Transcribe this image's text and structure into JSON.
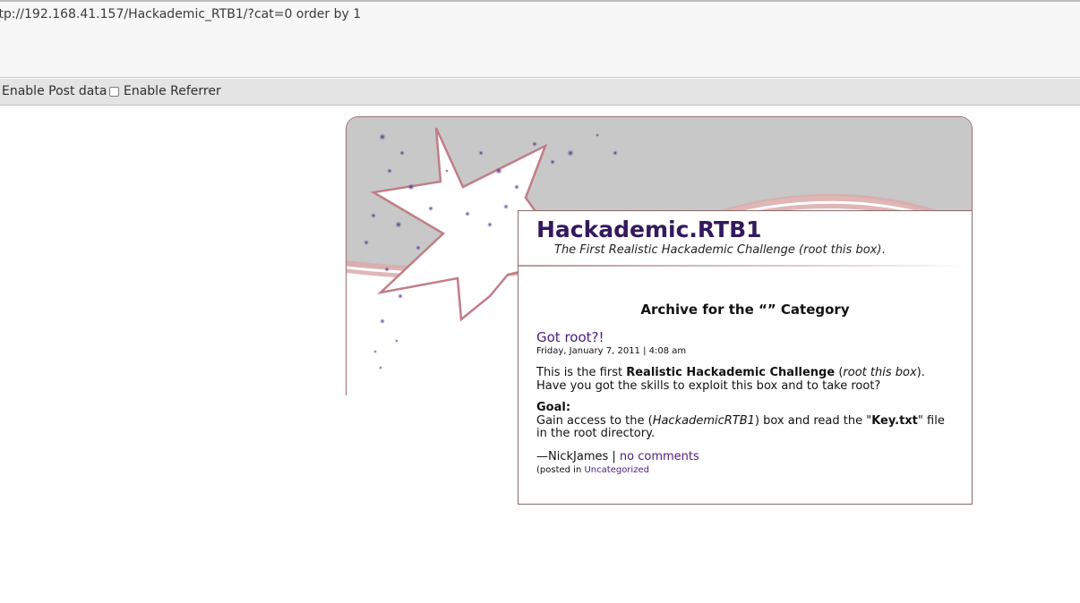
{
  "hackbar": {
    "url": "ttp://192.168.41.157/Hackademic_RTB1/?cat=0 order by 1",
    "enable_post_label": "Enable Post data",
    "enable_referrer_label": "Enable Referrer"
  },
  "blog": {
    "title": "Hackademic.RTB1",
    "tagline_italic": "The First Realistic Hackademic Challenge (root this box)",
    "tagline_end": "."
  },
  "archive": {
    "heading": "Archive for the “” Category"
  },
  "post": {
    "title": "Got root?!",
    "date": "Friday, January 7, 2011 | 4:08 am",
    "p1_a": "This is the first ",
    "p1_b": "Realistic Hackademic Challenge",
    "p1_c": " (",
    "p1_d": "root this box",
    "p1_e": ").",
    "p1_f": "Have you got the skills to exploit this box and to take root?",
    "goal_label": "Goal:",
    "goal_a": "Gain access to the (",
    "goal_b": "HackademicRTB1",
    "goal_c": ") box and read the \"",
    "goal_d": "Key.txt",
    "goal_e": "\" file in the root directory.",
    "author": "—NickJames | ",
    "comments_link": "no comments",
    "posted_in_prefix": "(posted in ",
    "category_link": "Uncategorized"
  },
  "colors": {
    "title_purple": "#33195e",
    "link_purple": "#4b1d7a",
    "header_gray": "#c8c8c8",
    "swoosh_pink": "#d9aaaa"
  }
}
